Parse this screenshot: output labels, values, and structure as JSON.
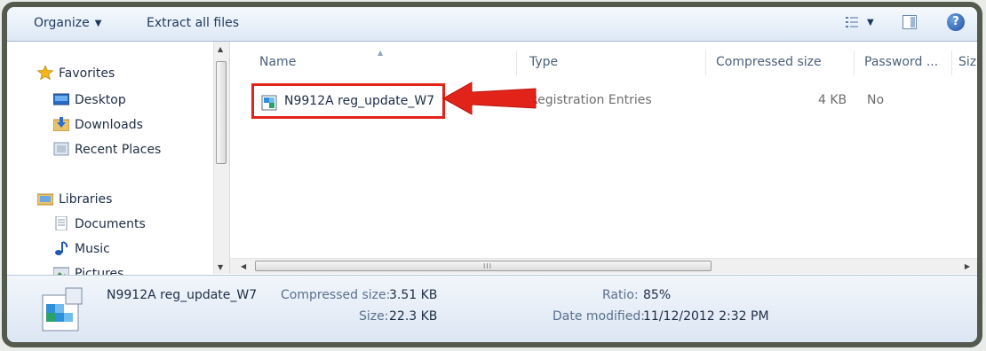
{
  "toolbar": {
    "organize_label": "Organize",
    "extract_label": "Extract all files",
    "help_label": "?"
  },
  "nav": {
    "favorites": "Favorites",
    "desktop": "Desktop",
    "downloads": "Downloads",
    "recent_places": "Recent Places",
    "libraries": "Libraries",
    "documents": "Documents",
    "music": "Music",
    "pictures": "Pictures"
  },
  "columns": {
    "name": "Name",
    "type": "Type",
    "compressed_size": "Compressed size",
    "password": "Password ...",
    "size": "Size"
  },
  "file_row": {
    "name": "N9912A reg_update_W7",
    "type": "Registration Entries",
    "compressed_size": "4 KB",
    "password": "No"
  },
  "details": {
    "filename": "N9912A reg_update_W7",
    "compressed_size_label": "Compressed size:",
    "compressed_size_value": "3.51 KB",
    "size_label": "Size:",
    "size_value": "22.3 KB",
    "ratio_label": "Ratio:",
    "ratio_value": "85%",
    "date_modified_label": "Date modified:",
    "date_modified_value": "11/12/2012 2:32 PM"
  },
  "scroll_grip": "III",
  "colors": {
    "frame": "#545a4e",
    "highlight_box": "#e2231a",
    "arrow": "#e2231a"
  }
}
